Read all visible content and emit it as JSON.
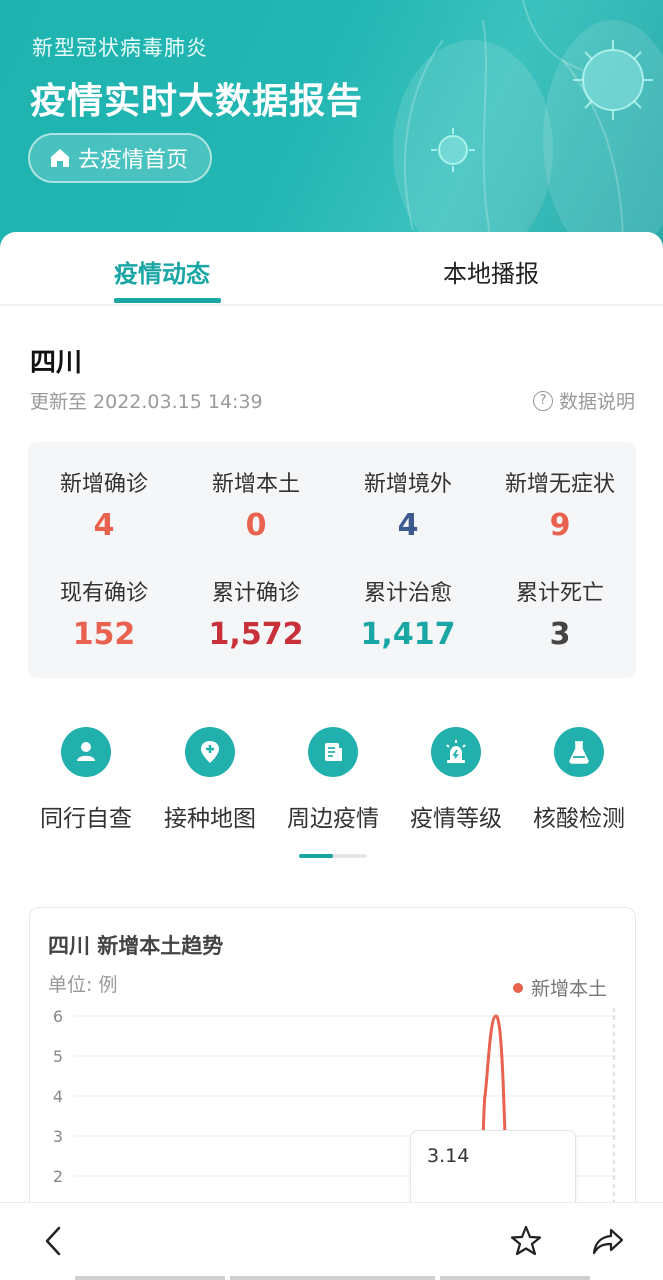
{
  "banner": {
    "subtitle": "新型冠状病毒肺炎",
    "title": "疫情实时大数据报告",
    "home_button": "去疫情首页"
  },
  "tabs": [
    {
      "label": "疫情动态",
      "active": true
    },
    {
      "label": "本地播报",
      "active": false
    }
  ],
  "region": {
    "name": "四川",
    "updated": "更新至 2022.03.15 14:39",
    "data_note": "数据说明",
    "data_note_icon": "question-circle-icon"
  },
  "stats": [
    {
      "label": "新增确诊",
      "value": "4",
      "color": "#e8624f"
    },
    {
      "label": "新增本土",
      "value": "0",
      "color": "#e8624f"
    },
    {
      "label": "新增境外",
      "value": "4",
      "color": "#3d5a8f"
    },
    {
      "label": "新增无症状",
      "value": "9",
      "color": "#e8624f"
    },
    {
      "label": "现有确诊",
      "value": "152",
      "color": "#e8624f"
    },
    {
      "label": "累计确诊",
      "value": "1,572",
      "color": "#c8303a"
    },
    {
      "label": "累计治愈",
      "value": "1,417",
      "color": "#1aa6a4"
    },
    {
      "label": "累计死亡",
      "value": "3",
      "color": "#444444"
    }
  ],
  "quick_links": [
    {
      "label": "同行自查",
      "icon": "person-icon"
    },
    {
      "label": "接种地图",
      "icon": "map-pin-plus-icon"
    },
    {
      "label": "周边疫情",
      "icon": "document-icon"
    },
    {
      "label": "疫情等级",
      "icon": "alert-light-icon"
    },
    {
      "label": "核酸检测",
      "icon": "flask-icon"
    }
  ],
  "trend": {
    "title": "四川 新增本土趋势",
    "unit": "单位: 例",
    "legend": "新增本土",
    "tooltip_date": "3.14"
  },
  "chart_data": {
    "type": "line",
    "title": "四川 新增本土趋势",
    "ylabel": "单位: 例",
    "y_ticks": [
      "6",
      "5",
      "4",
      "3",
      "2"
    ],
    "ylim": [
      1,
      6
    ],
    "series": [
      {
        "name": "新增本土",
        "color": "#e8624f",
        "peak_value": 6
      }
    ],
    "grid": true
  },
  "colors": {
    "accent": "#1aa6a4",
    "banner": "#22b6b3",
    "series": "#e8624f"
  }
}
